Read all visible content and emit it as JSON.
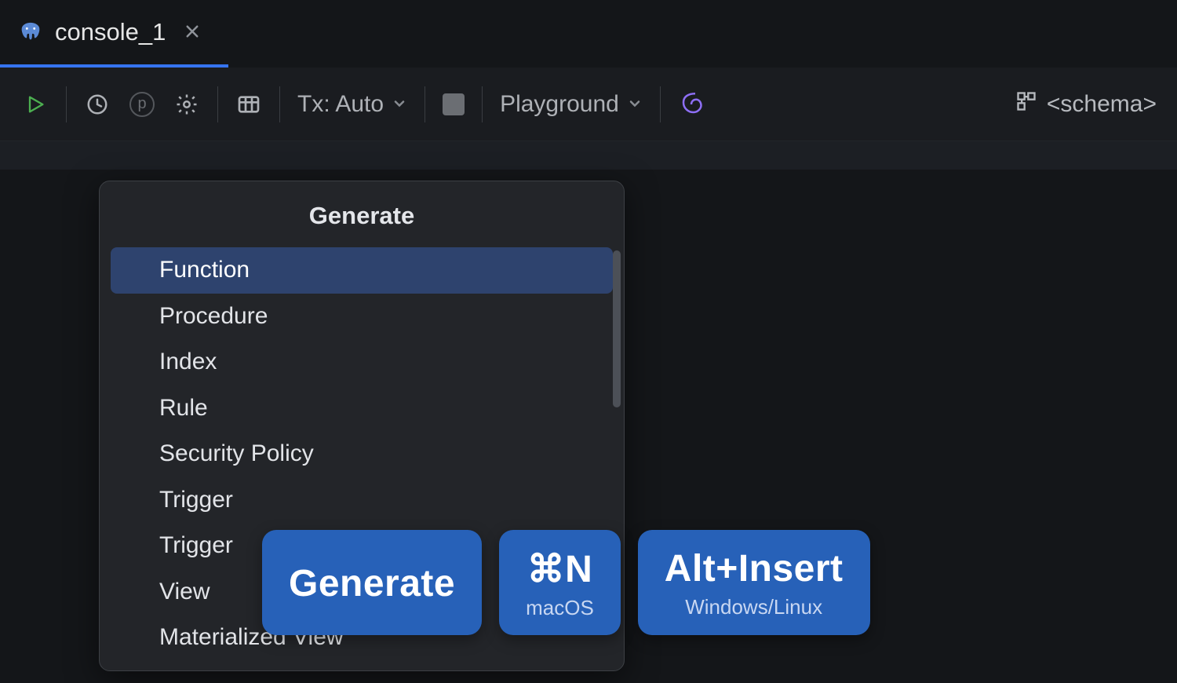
{
  "tab": {
    "title": "console_1",
    "icon": "postgres-elephant-icon"
  },
  "toolbar": {
    "tx_label": "Tx: Auto",
    "mode_label": "Playground",
    "schema_label": "<schema>"
  },
  "popup": {
    "title": "Generate",
    "items": [
      {
        "label": "Function",
        "selected": true
      },
      {
        "label": "Procedure",
        "selected": false
      },
      {
        "label": "Index",
        "selected": false
      },
      {
        "label": "Rule",
        "selected": false
      },
      {
        "label": "Security Policy",
        "selected": false
      },
      {
        "label": "Trigger",
        "selected": false
      },
      {
        "label": "Trigger",
        "selected": false
      },
      {
        "label": "View",
        "selected": false
      },
      {
        "label": "Materialized View",
        "selected": false
      }
    ]
  },
  "shortcuts": {
    "action": "Generate",
    "mac_key": "⌘N",
    "mac_os": "macOS",
    "win_key": "Alt+Insert",
    "win_os": "Windows/Linux"
  }
}
